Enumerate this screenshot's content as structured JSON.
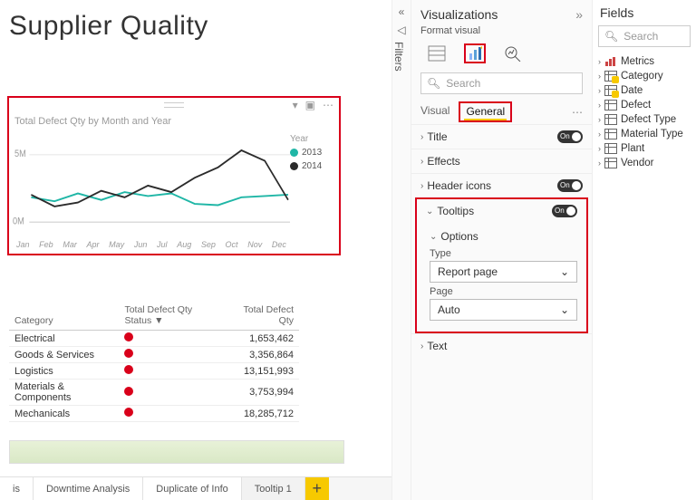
{
  "page_title": "Supplier Quality",
  "chart": {
    "title": "Total Defect Qty by Month and Year",
    "legend_title": "Year",
    "ylabels": [
      "5M",
      "0M"
    ]
  },
  "chart_data": {
    "type": "line",
    "categories": [
      "Jan",
      "Feb",
      "Mar",
      "Apr",
      "May",
      "Jun",
      "Jul",
      "Aug",
      "Sep",
      "Oct",
      "Nov",
      "Dec"
    ],
    "series": [
      {
        "name": "2013",
        "color": "#1fb6a6",
        "values": [
          1.9,
          1.6,
          2.2,
          1.7,
          2.3,
          2.0,
          2.2,
          1.4,
          1.3,
          1.9,
          2.0,
          2.1
        ]
      },
      {
        "name": "2014",
        "color": "#2b2b2b",
        "values": [
          2.1,
          1.2,
          1.5,
          2.4,
          1.9,
          2.8,
          2.3,
          3.4,
          4.2,
          5.5,
          4.7,
          1.7
        ]
      }
    ],
    "ylim": [
      0,
      6
    ],
    "ylabel": "",
    "xlabel": ""
  },
  "table": {
    "columns": [
      "Category",
      "Total Defect Qty Status",
      "Total Defect Qty"
    ],
    "sort_arrow": "▼",
    "rows": [
      {
        "cat": "Electrical",
        "qty": "1,653,462"
      },
      {
        "cat": "Goods & Services",
        "qty": "3,356,864"
      },
      {
        "cat": "Logistics",
        "qty": "13,151,993"
      },
      {
        "cat": "Materials & Components",
        "qty": "3,753,994"
      },
      {
        "cat": "Mechanicals",
        "qty": "18,285,712"
      }
    ]
  },
  "tabs": [
    "is",
    "Downtime Analysis",
    "Duplicate of Info",
    "Tooltip 1"
  ],
  "filters_label": "Filters",
  "viz": {
    "title": "Visualizations",
    "sub": "Format visual",
    "search_ph": "Search",
    "cat_visual": "Visual",
    "cat_general": "General",
    "sec_title": "Title",
    "sec_effects": "Effects",
    "sec_header": "Header icons",
    "sec_tooltips": "Tooltips",
    "options": "Options",
    "type_lbl": "Type",
    "type_val": "Report page",
    "page_lbl": "Page",
    "page_val": "Auto",
    "sec_text": "Text",
    "on": "On"
  },
  "fields": {
    "title": "Fields",
    "search_ph": "Search",
    "items": [
      {
        "name": "Metrics",
        "checked": true,
        "metric": true
      },
      {
        "name": "Category",
        "checked": true
      },
      {
        "name": "Date",
        "checked": true
      },
      {
        "name": "Defect",
        "checked": false
      },
      {
        "name": "Defect Type",
        "checked": false
      },
      {
        "name": "Material Type",
        "checked": false
      },
      {
        "name": "Plant",
        "checked": false
      },
      {
        "name": "Vendor",
        "checked": false
      }
    ]
  }
}
